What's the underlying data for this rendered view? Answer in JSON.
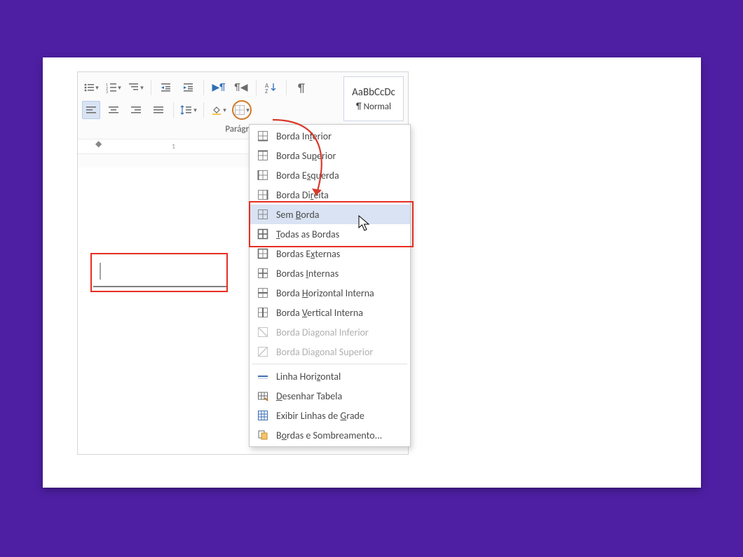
{
  "ribbon": {
    "group_label": "Parágrafo",
    "row1": {
      "bullets": "bullets-icon",
      "numbering": "numbering-icon",
      "multilevel": "multilevel-list-icon",
      "dec_indent": "decrease-indent-icon",
      "inc_indent": "increase-indent-icon",
      "ltr": "ltr-icon",
      "rtl": "rtl-icon",
      "sort": "sort-icon",
      "showhide": "show-hide-icon"
    },
    "row2": {
      "align_l": "align-left-icon",
      "align_c": "align-center-icon",
      "align_r": "align-right-icon",
      "align_j": "align-justify-icon",
      "line_sp": "line-spacing-icon",
      "shading": "shading-icon",
      "borders": "borders-icon"
    }
  },
  "style_gallery": {
    "preview": "AaBbCcDc",
    "name": "¶ Normal"
  },
  "ruler": {
    "mark1": "1"
  },
  "dropdown": {
    "items": [
      {
        "label_pre": "Borda In",
        "u": "f",
        "label_post": "erior",
        "icon": "border-bottom-icon"
      },
      {
        "label_pre": "Borda Su",
        "u": "p",
        "label_post": "erior",
        "icon": "border-top-icon"
      },
      {
        "label_pre": "Borda E",
        "u": "s",
        "label_post": "querda",
        "icon": "border-left-icon"
      },
      {
        "label_pre": "Borda Di",
        "u": "r",
        "label_post": "eita",
        "icon": "border-right-icon"
      },
      {
        "label_pre": "Sem ",
        "u": "B",
        "label_post": "orda",
        "icon": "no-border-icon",
        "hover": true
      },
      {
        "label_pre": "",
        "u": "T",
        "label_post": "odas as Bordas",
        "icon": "all-borders-icon"
      },
      {
        "label_pre": "Bordas E",
        "u": "x",
        "label_post": "ternas",
        "icon": "outside-borders-icon"
      },
      {
        "label_pre": "Bordas ",
        "u": "I",
        "label_post": "nternas",
        "icon": "inside-borders-icon"
      },
      {
        "label_pre": "Borda ",
        "u": "H",
        "label_post": "orizontal Interna",
        "icon": "inside-h-border-icon"
      },
      {
        "label_pre": "Borda ",
        "u": "V",
        "label_post": "ertical Interna",
        "icon": "inside-v-border-icon"
      },
      {
        "label_pre": "Borda Diagonal Inferior",
        "u": "",
        "label_post": "",
        "icon": "diag-down-border-icon",
        "disabled": true
      },
      {
        "label_pre": "Borda Diagonal Superior",
        "u": "",
        "label_post": "",
        "icon": "diag-up-border-icon",
        "disabled": true
      },
      {
        "sep": true
      },
      {
        "label_pre": "Linha Hori",
        "u": "z",
        "label_post": "ontal",
        "icon": "hline-icon"
      },
      {
        "label_pre": "",
        "u": "D",
        "label_post": "esenhar Tabela",
        "icon": "draw-table-icon"
      },
      {
        "label_pre": "Exibir Linhas de ",
        "u": "G",
        "label_post": "rade",
        "icon": "gridlines-icon"
      },
      {
        "label_pre": "B",
        "u": "o",
        "label_post": "rdas e Sombreamento...",
        "icon": "borders-shading-icon"
      }
    ]
  }
}
